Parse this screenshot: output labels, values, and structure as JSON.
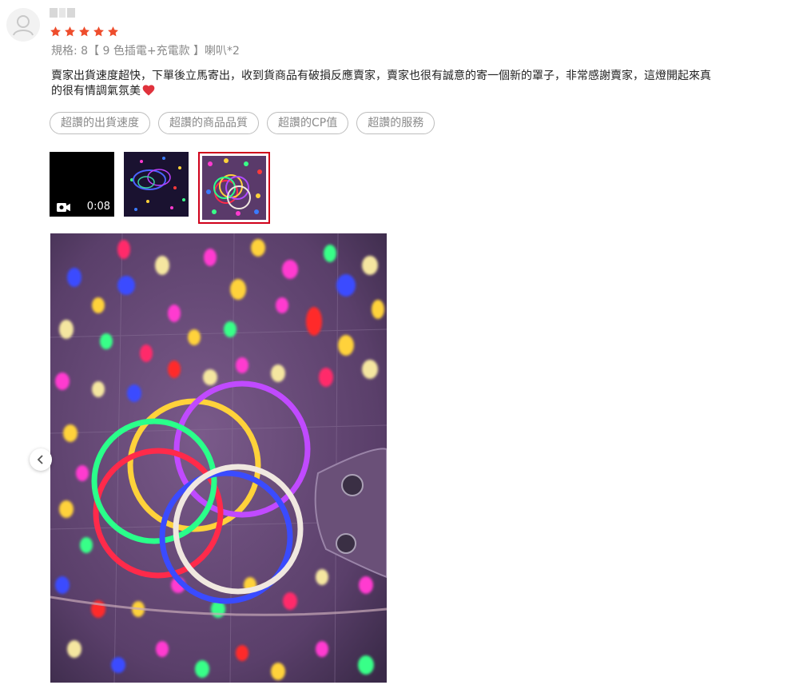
{
  "review": {
    "rating": 5,
    "variant": "規格: 8【 9 色插電+充電款 】喇叭*2",
    "text_line1": "賣家出貨速度超快，下單後立馬寄出，收到貨商品有破損反應賣家，賣家也很有誠意的寄一個新的罩子，非常感謝賣家，這燈開起來真",
    "text_line2": "的很有情調氣氛美",
    "tags": [
      "超讚的出貨速度",
      "超讚的商品品質",
      "超讚的CP值",
      "超讚的服務"
    ],
    "media": {
      "video_duration": "0:08",
      "selected_index": 2
    }
  },
  "colors": {
    "star": "#ee4d2d",
    "selected_border": "#d0011b",
    "heart": "#e0323c"
  },
  "icons": [
    "avatar-placeholder-icon",
    "star-icon",
    "heart-icon",
    "video-camera-icon",
    "chevron-left-icon"
  ]
}
